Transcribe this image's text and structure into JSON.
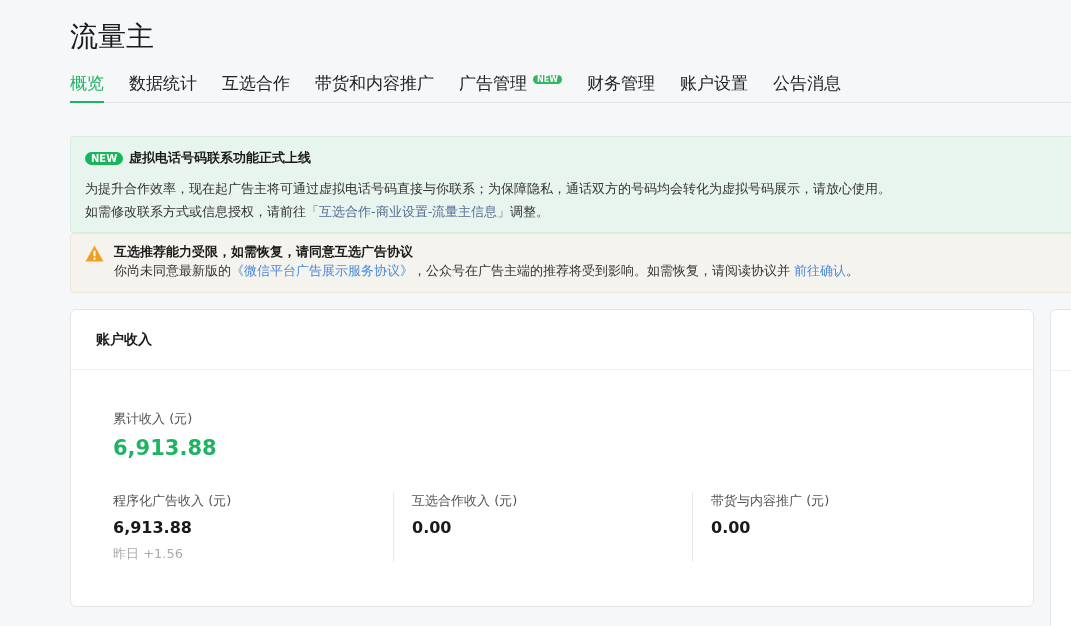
{
  "page_title": "流量主",
  "tabs": [
    {
      "label": "概览",
      "selected": true
    },
    {
      "label": "数据统计",
      "selected": false
    },
    {
      "label": "互选合作",
      "selected": false
    },
    {
      "label": "带货和内容推广",
      "selected": false
    },
    {
      "label": "广告管理",
      "selected": false,
      "badge": "NEW"
    },
    {
      "label": "财务管理",
      "selected": false
    },
    {
      "label": "账户设置",
      "selected": false
    },
    {
      "label": "公告消息",
      "selected": false
    }
  ],
  "notices": [
    {
      "kind": "new",
      "badge": "NEW",
      "title": "虚拟电话号码联系功能正式上线",
      "lines": [
        [
          {
            "text": "为提升合作效率，现在起广告主将可通过虚拟电话号码直接与你联系；为保障隐私，通话双方的号码均会转化为虚拟号码展示，请放心使用。",
            "link": false
          }
        ],
        [
          {
            "text": "如需修改联系方式或信息授权，请前往",
            "link": false
          },
          {
            "text": "「互选合作-商业设置-流量主信息」",
            "link": true
          },
          {
            "text": "调整。",
            "link": false
          }
        ]
      ]
    },
    {
      "kind": "warning",
      "title": "互选推荐能力受限，如需恢复，请同意互选广告协议",
      "lines": [
        [
          {
            "text": "你尚未同意最新版的",
            "link": false
          },
          {
            "text": "《微信平台广告展示服务协议》",
            "link": true
          },
          {
            "text": "，公众号在广告主端的推荐将受到影响。如需恢复，请阅读协议并 ",
            "link": false
          },
          {
            "text": "前往确认",
            "link": true
          },
          {
            "text": "。",
            "link": false
          }
        ]
      ]
    }
  ],
  "income_card": {
    "title": "账户收入",
    "total": {
      "label": "累计收入 (元)",
      "value": "6,913.88"
    },
    "stats": [
      {
        "label": "程序化广告收入 (元)",
        "value": "6,913.88",
        "note": "昨日 +1.56"
      },
      {
        "label": "互选合作收入 (元)",
        "value": "0.00"
      },
      {
        "label": "带货与内容推广 (元)",
        "value": "0.00"
      }
    ]
  }
}
